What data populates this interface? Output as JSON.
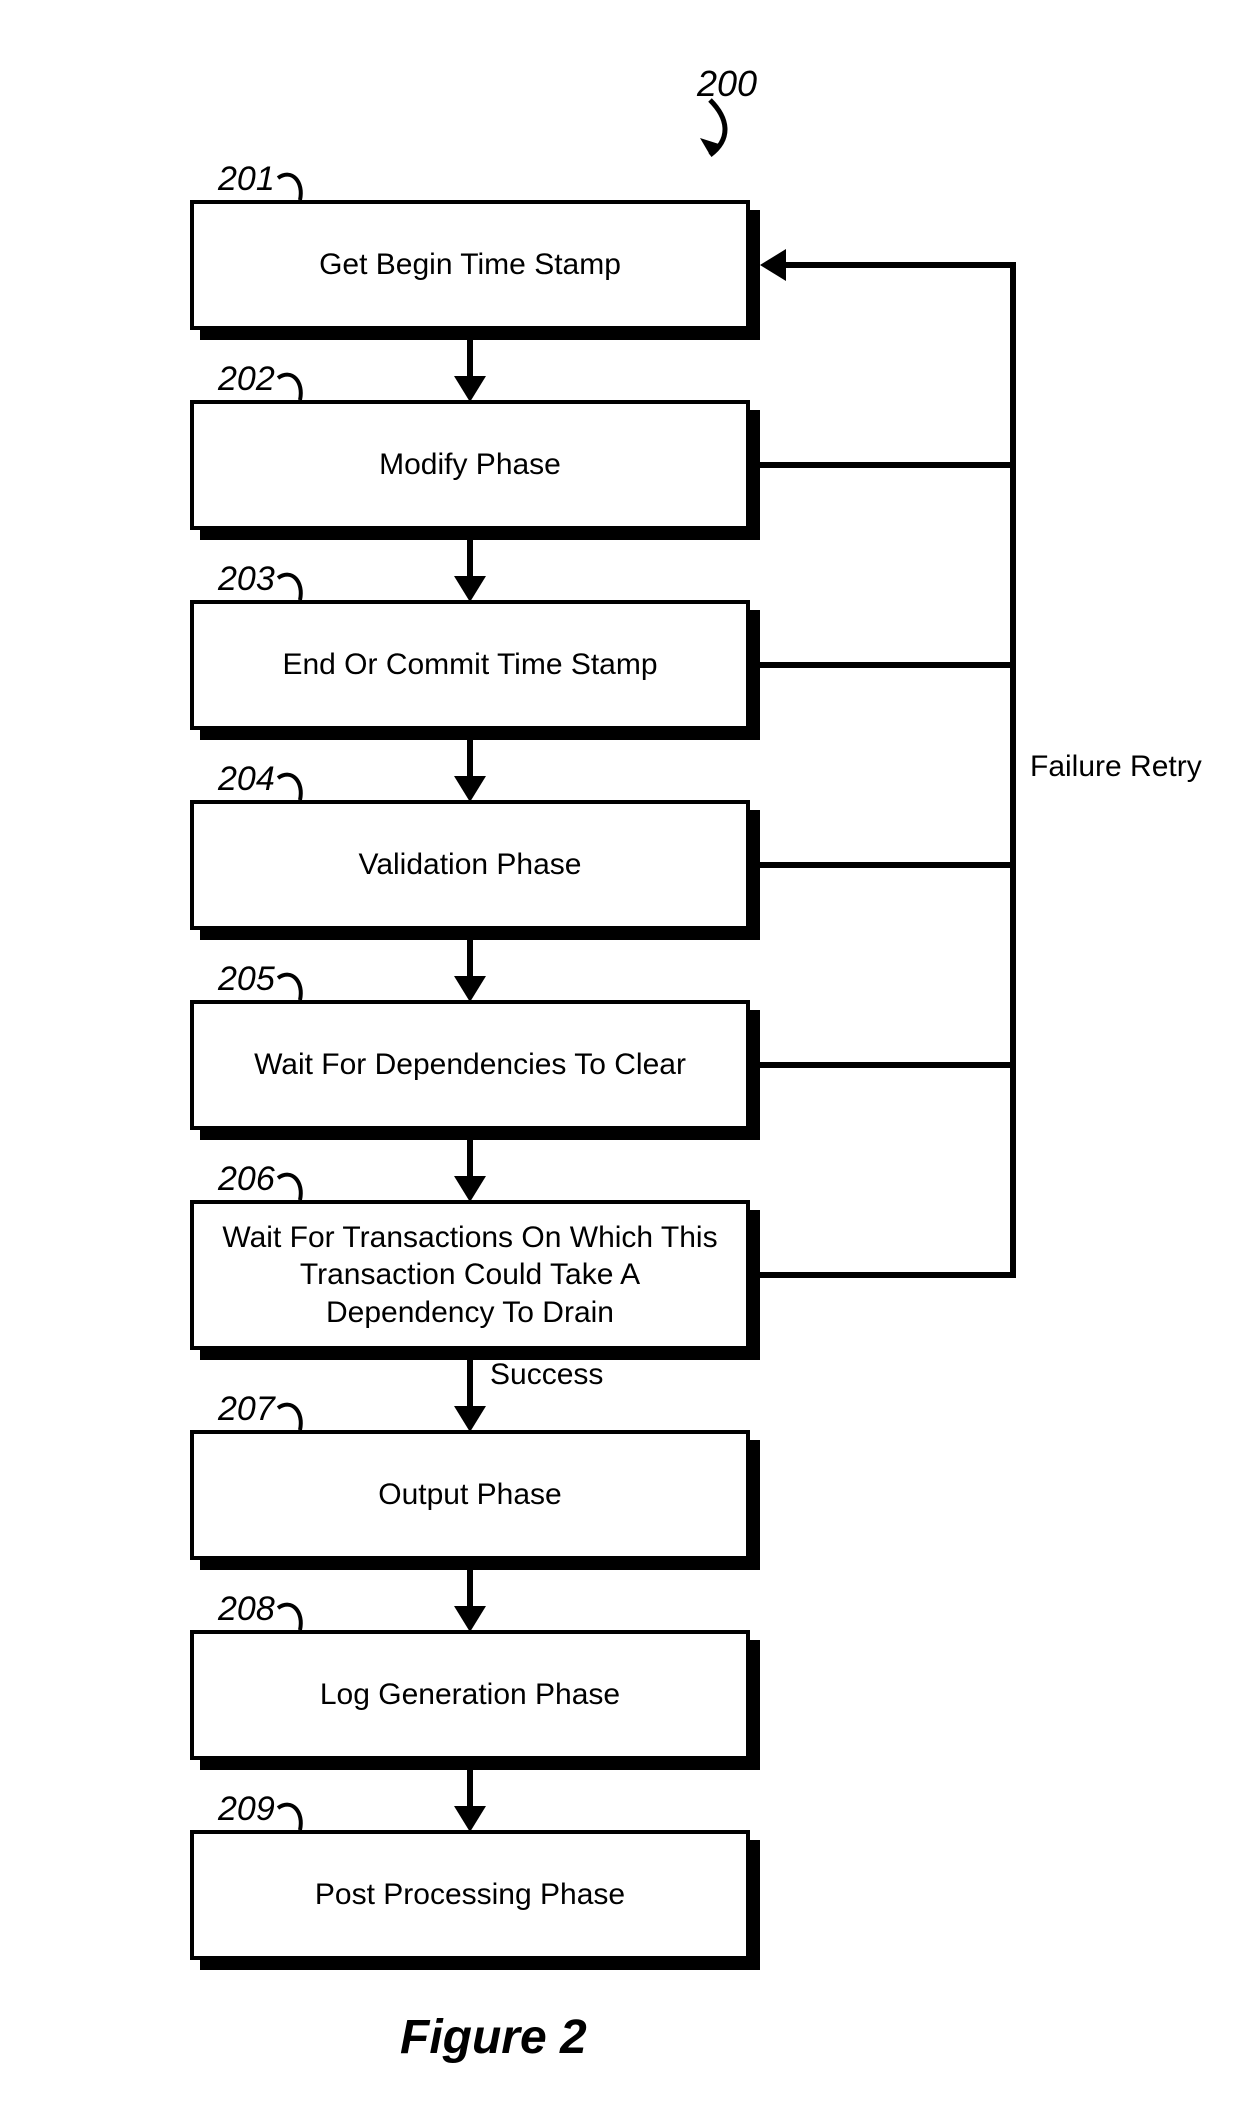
{
  "figure": {
    "ref": "200",
    "title": "Figure 2"
  },
  "boxes": [
    {
      "ref": "201",
      "text": "Get Begin Time Stamp"
    },
    {
      "ref": "202",
      "text": "Modify Phase"
    },
    {
      "ref": "203",
      "text": "End Or Commit Time Stamp"
    },
    {
      "ref": "204",
      "text": "Validation Phase"
    },
    {
      "ref": "205",
      "text": "Wait For Dependencies To Clear"
    },
    {
      "ref": "206",
      "text": "Wait For Transactions On Which This Transaction Could Take A Dependency To Drain"
    },
    {
      "ref": "207",
      "text": "Output Phase"
    },
    {
      "ref": "208",
      "text": "Log Generation Phase"
    },
    {
      "ref": "209",
      "text": "Post Processing Phase"
    }
  ],
  "edge_labels": {
    "failure_retry": "Failure Retry",
    "success": "Success"
  }
}
